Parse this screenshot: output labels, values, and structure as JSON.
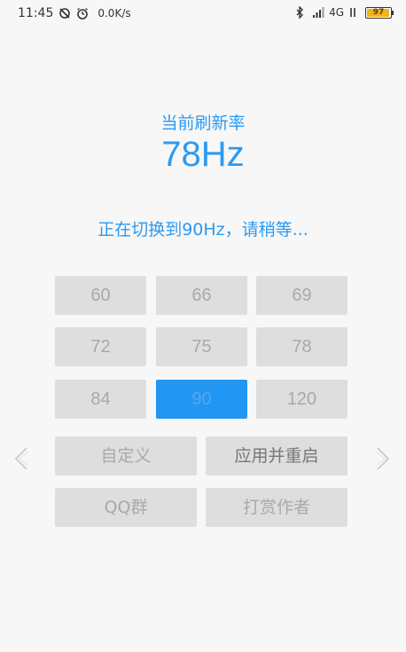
{
  "status_bar": {
    "time": "11:45",
    "speed": "0.0K/s",
    "network": "4G",
    "battery": "97",
    "battery_level_pct": 97
  },
  "header": {
    "label": "当前刷新率",
    "current_rate": "78Hz",
    "message": "正在切换到90Hz，请稍等..."
  },
  "rates": [
    "60",
    "66",
    "69",
    "72",
    "75",
    "78",
    "84",
    "90",
    "120"
  ],
  "selected_rate": "90",
  "actions": {
    "custom": "自定义",
    "apply_restart": "应用并重启",
    "qq_group": "QQ群",
    "donate": "打赏作者"
  },
  "colors": {
    "accent": "#2c9af2",
    "button_bg": "#dedede",
    "selected_bg": "#2196f3"
  }
}
